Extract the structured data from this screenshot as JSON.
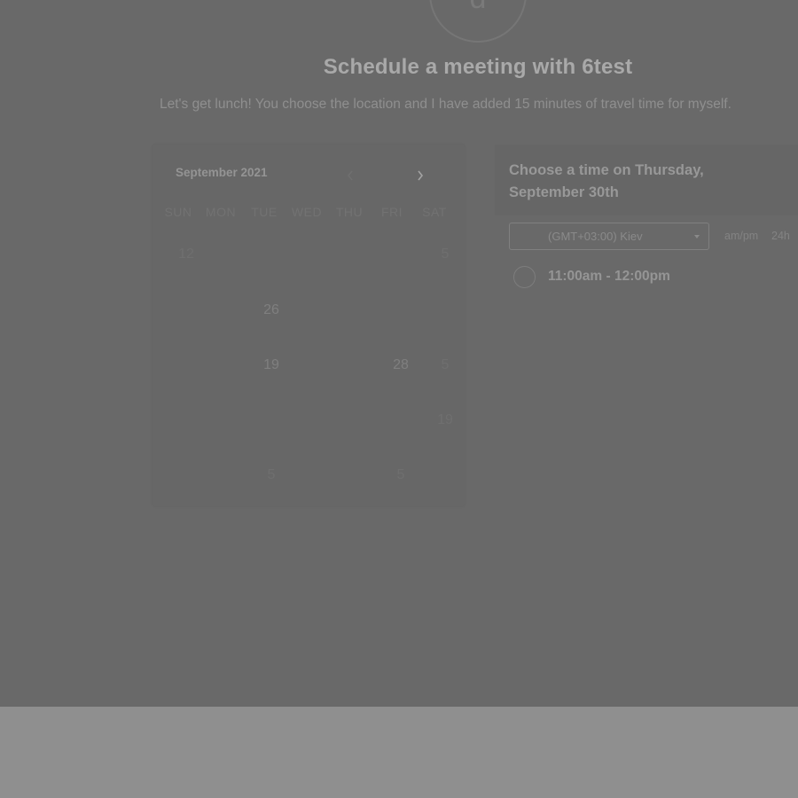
{
  "header": {
    "avatar_initial": "d",
    "title": "Schedule a meeting with 6test",
    "description": "Let's get lunch! You choose the location and I have added 15 minutes of travel time for myself."
  },
  "calendar": {
    "month_label": "September 2021",
    "prev_icon": "chevron-left-icon",
    "next_icon": "chevron-right-icon",
    "weekdays": [
      "SUN",
      "MON",
      "TUE",
      "WED",
      "THU",
      "FRI",
      "SAT"
    ],
    "weeks": [
      [
        "12",
        "",
        "",
        "",
        "",
        "",
        "5"
      ],
      [
        "",
        "",
        "26",
        "",
        "",
        "",
        ""
      ],
      [
        "",
        "",
        "19",
        "",
        "",
        "28",
        "5"
      ],
      [
        "",
        "",
        "",
        "",
        "",
        "",
        "19"
      ],
      [
        "",
        "",
        "5",
        "",
        "",
        "5",
        ""
      ]
    ]
  },
  "panel": {
    "heading": "Choose a time on Thursday, September 30th",
    "timezone": "(GMT+03:00) Kiev",
    "format_ampm": "am/pm",
    "format_24h": "24h",
    "slots": [
      {
        "label": "11:00am - 12:00pm"
      }
    ]
  },
  "colors": {
    "overlay": "#696969",
    "footer": "#8f8f8f"
  }
}
